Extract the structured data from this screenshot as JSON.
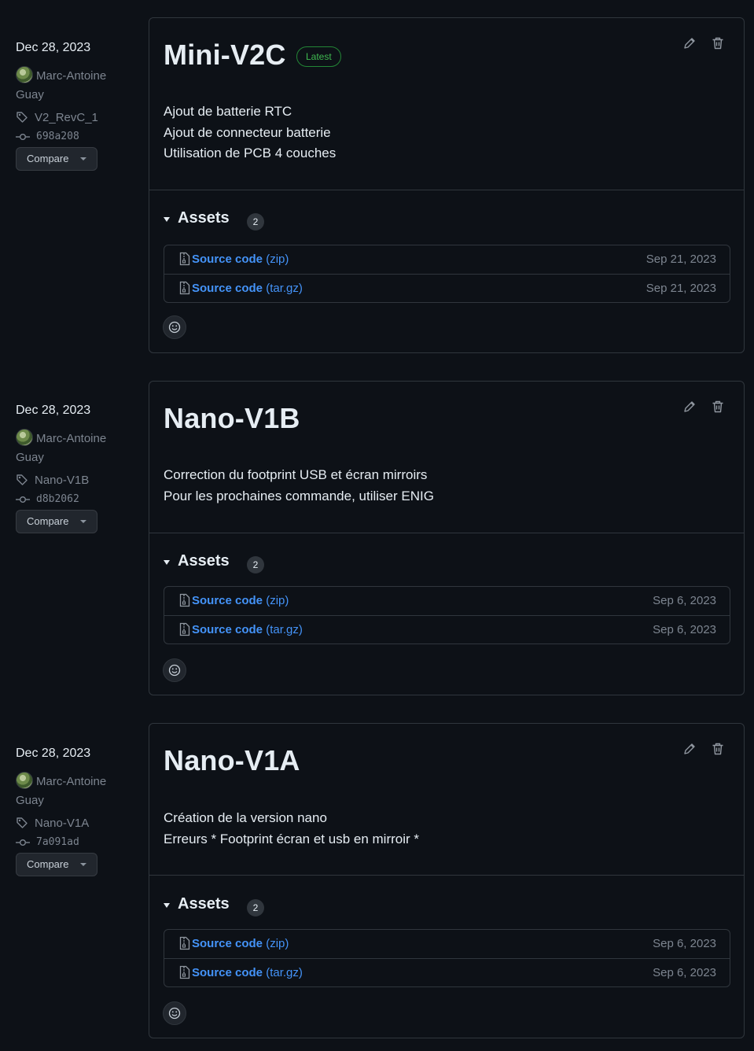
{
  "releases": [
    {
      "date": "Dec 28, 2023",
      "author": "Marc-Antoine Guay",
      "tag": "V2_RevC_1",
      "commit": "698a208",
      "compare_label": "Compare",
      "title": "Mini-V2C",
      "badge": "Latest",
      "notes": [
        "Ajout de batterie RTC",
        "Ajout de connecteur batterie",
        "Utilisation de PCB 4 couches"
      ],
      "assets_label": "Assets",
      "assets_count": "2",
      "assets": [
        {
          "name": "Source code",
          "ext": "(zip)",
          "date": "Sep 21, 2023"
        },
        {
          "name": "Source code",
          "ext": "(tar.gz)",
          "date": "Sep 21, 2023"
        }
      ]
    },
    {
      "date": "Dec 28, 2023",
      "author": "Marc-Antoine Guay",
      "tag": "Nano-V1B",
      "commit": "d8b2062",
      "compare_label": "Compare",
      "title": "Nano-V1B",
      "notes": [
        "Correction du footprint USB et écran mirroirs",
        "Pour les prochaines commande, utiliser ENIG"
      ],
      "assets_label": "Assets",
      "assets_count": "2",
      "assets": [
        {
          "name": "Source code",
          "ext": "(zip)",
          "date": "Sep 6, 2023"
        },
        {
          "name": "Source code",
          "ext": "(tar.gz)",
          "date": "Sep 6, 2023"
        }
      ]
    },
    {
      "date": "Dec 28, 2023",
      "author": "Marc-Antoine Guay",
      "tag": "Nano-V1A",
      "commit": "7a091ad",
      "compare_label": "Compare",
      "title": "Nano-V1A",
      "notes": [
        "Création de la version nano",
        "Erreurs * Footprint écran et usb en mirroir *"
      ],
      "assets_label": "Assets",
      "assets_count": "2",
      "assets": [
        {
          "name": "Source code",
          "ext": "(zip)",
          "date": "Sep 6, 2023"
        },
        {
          "name": "Source code",
          "ext": "(tar.gz)",
          "date": "Sep 6, 2023"
        }
      ]
    }
  ],
  "icons": {
    "tag": "tag-icon",
    "commit": "git-commit-icon",
    "edit": "pencil-icon",
    "delete": "trash-icon",
    "asset": "file-zip-icon",
    "reaction": "smiley-icon"
  },
  "colors": {
    "background": "#0d1117",
    "border": "#30363d",
    "link": "#4493f8",
    "latest": "#3fb950",
    "muted": "#7d8590"
  }
}
